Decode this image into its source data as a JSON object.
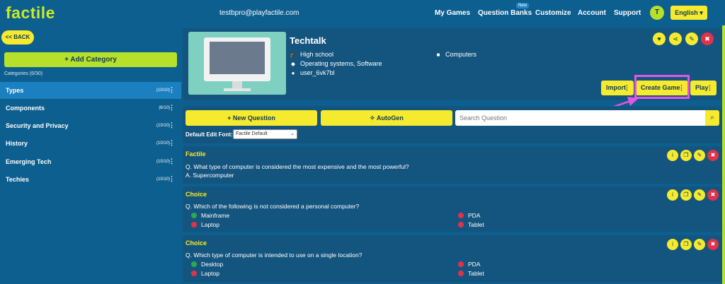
{
  "app": {
    "logo": "factile",
    "email": "testbpro@playfactile.com"
  },
  "nav": {
    "my_games": "My Games",
    "question_banks": "Question Banks",
    "new_badge": "New",
    "customize": "Customize",
    "account": "Account",
    "support": "Support",
    "avatar_initial": "T",
    "language": "English"
  },
  "sidebar": {
    "back_label": "<< BACK",
    "add_category": "+ Add Category",
    "categories_count": "Categories (6/30)",
    "categories": [
      {
        "label": "Types",
        "count": "(10/10)",
        "active": true
      },
      {
        "label": "Components",
        "count": "(6/10)"
      },
      {
        "label": "Security and Privacy",
        "count": "(10/10)"
      },
      {
        "label": "History",
        "count": "(10/10)"
      },
      {
        "label": "Emerging Tech",
        "count": "(10/10)"
      },
      {
        "label": "Techies",
        "count": "(10/10)"
      }
    ]
  },
  "bank": {
    "title": "Techtalk",
    "grade": "High school",
    "subject": "Computers",
    "tags": "Operating systems, Software",
    "owner": "user_6vk7bl",
    "import_label": "Import",
    "create_game_label": "Create Game",
    "play_label": "Play"
  },
  "toolbar": {
    "new_question": "+ New Question",
    "autogen": "AutoGen",
    "search_placeholder": "Search Question",
    "font_label": "Default Edit Font:",
    "font_value": "Factile Default"
  },
  "questions": [
    {
      "type": "Factile",
      "question": "Q. What type of computer is considered the most expensive and the most powerful?",
      "answer": "A. Supercomputer"
    },
    {
      "type": "Choice",
      "question": "Q. Which of the following is not considered a personal computer?",
      "options": [
        {
          "text": "Mainframe",
          "correct": true
        },
        {
          "text": "PDA",
          "correct": false
        },
        {
          "text": "Laptop",
          "correct": false
        },
        {
          "text": "Tablet",
          "correct": false
        }
      ]
    },
    {
      "type": "Choice",
      "question": "Q. Which type of computer is intended to use on a single location?",
      "options": [
        {
          "text": "Desktop",
          "correct": true
        },
        {
          "text": "PDA",
          "correct": false
        },
        {
          "text": "Laptop",
          "correct": false
        },
        {
          "text": "Tablet",
          "correct": false
        }
      ]
    }
  ],
  "colors": {
    "primary_bg": "#0d5f8f",
    "panel_bg": "#14557f",
    "accent_yellow": "#f5ea2d",
    "accent_green": "#b7e02b",
    "danger_red": "#e0334a",
    "correct_green": "#2fa84f",
    "wrong_red": "#e0334a",
    "annotation_magenta": "#e356e3"
  }
}
